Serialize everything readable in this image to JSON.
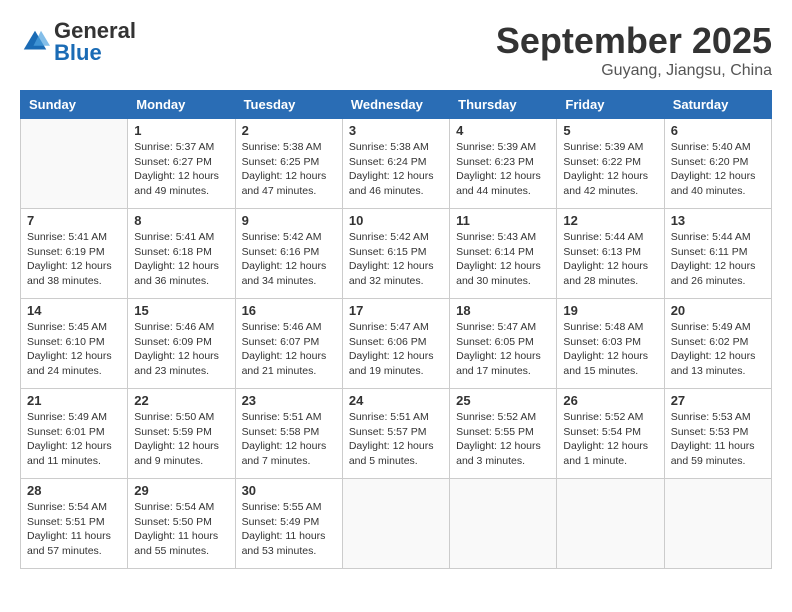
{
  "header": {
    "logo_general": "General",
    "logo_blue": "Blue",
    "month": "September 2025",
    "location": "Guyang, Jiangsu, China"
  },
  "days_of_week": [
    "Sunday",
    "Monday",
    "Tuesday",
    "Wednesday",
    "Thursday",
    "Friday",
    "Saturday"
  ],
  "weeks": [
    [
      {
        "day": "",
        "info": ""
      },
      {
        "day": "1",
        "info": "Sunrise: 5:37 AM\nSunset: 6:27 PM\nDaylight: 12 hours\nand 49 minutes."
      },
      {
        "day": "2",
        "info": "Sunrise: 5:38 AM\nSunset: 6:25 PM\nDaylight: 12 hours\nand 47 minutes."
      },
      {
        "day": "3",
        "info": "Sunrise: 5:38 AM\nSunset: 6:24 PM\nDaylight: 12 hours\nand 46 minutes."
      },
      {
        "day": "4",
        "info": "Sunrise: 5:39 AM\nSunset: 6:23 PM\nDaylight: 12 hours\nand 44 minutes."
      },
      {
        "day": "5",
        "info": "Sunrise: 5:39 AM\nSunset: 6:22 PM\nDaylight: 12 hours\nand 42 minutes."
      },
      {
        "day": "6",
        "info": "Sunrise: 5:40 AM\nSunset: 6:20 PM\nDaylight: 12 hours\nand 40 minutes."
      }
    ],
    [
      {
        "day": "7",
        "info": "Sunrise: 5:41 AM\nSunset: 6:19 PM\nDaylight: 12 hours\nand 38 minutes."
      },
      {
        "day": "8",
        "info": "Sunrise: 5:41 AM\nSunset: 6:18 PM\nDaylight: 12 hours\nand 36 minutes."
      },
      {
        "day": "9",
        "info": "Sunrise: 5:42 AM\nSunset: 6:16 PM\nDaylight: 12 hours\nand 34 minutes."
      },
      {
        "day": "10",
        "info": "Sunrise: 5:42 AM\nSunset: 6:15 PM\nDaylight: 12 hours\nand 32 minutes."
      },
      {
        "day": "11",
        "info": "Sunrise: 5:43 AM\nSunset: 6:14 PM\nDaylight: 12 hours\nand 30 minutes."
      },
      {
        "day": "12",
        "info": "Sunrise: 5:44 AM\nSunset: 6:13 PM\nDaylight: 12 hours\nand 28 minutes."
      },
      {
        "day": "13",
        "info": "Sunrise: 5:44 AM\nSunset: 6:11 PM\nDaylight: 12 hours\nand 26 minutes."
      }
    ],
    [
      {
        "day": "14",
        "info": "Sunrise: 5:45 AM\nSunset: 6:10 PM\nDaylight: 12 hours\nand 24 minutes."
      },
      {
        "day": "15",
        "info": "Sunrise: 5:46 AM\nSunset: 6:09 PM\nDaylight: 12 hours\nand 23 minutes."
      },
      {
        "day": "16",
        "info": "Sunrise: 5:46 AM\nSunset: 6:07 PM\nDaylight: 12 hours\nand 21 minutes."
      },
      {
        "day": "17",
        "info": "Sunrise: 5:47 AM\nSunset: 6:06 PM\nDaylight: 12 hours\nand 19 minutes."
      },
      {
        "day": "18",
        "info": "Sunrise: 5:47 AM\nSunset: 6:05 PM\nDaylight: 12 hours\nand 17 minutes."
      },
      {
        "day": "19",
        "info": "Sunrise: 5:48 AM\nSunset: 6:03 PM\nDaylight: 12 hours\nand 15 minutes."
      },
      {
        "day": "20",
        "info": "Sunrise: 5:49 AM\nSunset: 6:02 PM\nDaylight: 12 hours\nand 13 minutes."
      }
    ],
    [
      {
        "day": "21",
        "info": "Sunrise: 5:49 AM\nSunset: 6:01 PM\nDaylight: 12 hours\nand 11 minutes."
      },
      {
        "day": "22",
        "info": "Sunrise: 5:50 AM\nSunset: 5:59 PM\nDaylight: 12 hours\nand 9 minutes."
      },
      {
        "day": "23",
        "info": "Sunrise: 5:51 AM\nSunset: 5:58 PM\nDaylight: 12 hours\nand 7 minutes."
      },
      {
        "day": "24",
        "info": "Sunrise: 5:51 AM\nSunset: 5:57 PM\nDaylight: 12 hours\nand 5 minutes."
      },
      {
        "day": "25",
        "info": "Sunrise: 5:52 AM\nSunset: 5:55 PM\nDaylight: 12 hours\nand 3 minutes."
      },
      {
        "day": "26",
        "info": "Sunrise: 5:52 AM\nSunset: 5:54 PM\nDaylight: 12 hours\nand 1 minute."
      },
      {
        "day": "27",
        "info": "Sunrise: 5:53 AM\nSunset: 5:53 PM\nDaylight: 11 hours\nand 59 minutes."
      }
    ],
    [
      {
        "day": "28",
        "info": "Sunrise: 5:54 AM\nSunset: 5:51 PM\nDaylight: 11 hours\nand 57 minutes."
      },
      {
        "day": "29",
        "info": "Sunrise: 5:54 AM\nSunset: 5:50 PM\nDaylight: 11 hours\nand 55 minutes."
      },
      {
        "day": "30",
        "info": "Sunrise: 5:55 AM\nSunset: 5:49 PM\nDaylight: 11 hours\nand 53 minutes."
      },
      {
        "day": "",
        "info": ""
      },
      {
        "day": "",
        "info": ""
      },
      {
        "day": "",
        "info": ""
      },
      {
        "day": "",
        "info": ""
      }
    ]
  ]
}
